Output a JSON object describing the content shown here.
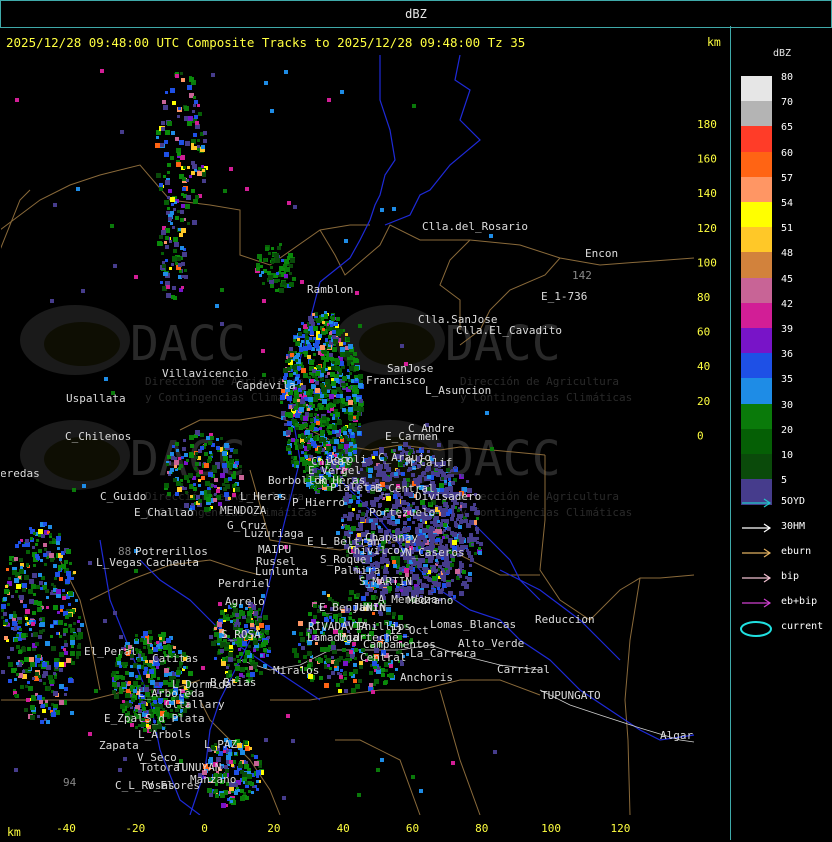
{
  "window": {
    "title": "dBZ"
  },
  "header": {
    "text": "2025/12/28 09:48:00 UTC Composite Tracks to 2025/12/28 09:48:00 Tz 35",
    "km_top": "km",
    "km_bottom": "km"
  },
  "axes": {
    "y_ticks": [
      "180",
      "160",
      "140",
      "120",
      "100",
      "80",
      "60",
      "40",
      "20",
      "0"
    ],
    "x_ticks": [
      "-40",
      "-20",
      "0",
      "20",
      "40",
      "60",
      "80",
      "100",
      "120"
    ]
  },
  "legend": {
    "title": "dBZ",
    "levels": [
      {
        "label": "80",
        "color": "#e6e6e6"
      },
      {
        "label": "70",
        "color": "#b4b4b4"
      },
      {
        "label": "65",
        "color": "#ff3c28"
      },
      {
        "label": "60",
        "color": "#ff6414"
      },
      {
        "label": "57",
        "color": "#ff9664"
      },
      {
        "label": "54",
        "color": "#ffff00"
      },
      {
        "label": "51",
        "color": "#ffc828"
      },
      {
        "label": "48",
        "color": "#d2823c"
      },
      {
        "label": "45",
        "color": "#c86496"
      },
      {
        "label": "42",
        "color": "#d21e96"
      },
      {
        "label": "39",
        "color": "#7814c8"
      },
      {
        "label": "36",
        "color": "#1e50e6"
      },
      {
        "label": "35",
        "color": "#1e8ce6"
      },
      {
        "label": "30",
        "color": "#0a7a0a"
      },
      {
        "label": "20",
        "color": "#055f05"
      },
      {
        "label": "10",
        "color": "#0a4a0a"
      },
      {
        "label": "5",
        "color": "#463c8c"
      }
    ],
    "tracks": [
      {
        "label": "5OYD",
        "color": "#20c8c8"
      },
      {
        "label": "30HM",
        "color": "#ffffff"
      },
      {
        "label": "eburn",
        "color": "#e0b060"
      },
      {
        "label": "bip",
        "color": "#f0c0d0"
      },
      {
        "label": "eb+bip",
        "color": "#d040d0"
      },
      {
        "label": "current",
        "color": "#20e0e0"
      }
    ]
  },
  "watermark": {
    "name": "DACC",
    "line1": "Dirección de Agricultura",
    "line2": "y Contingencias Climáticas"
  },
  "places": [
    {
      "name": "Clla.del_Rosario",
      "c": "#dcdcdc"
    },
    {
      "name": "Encon",
      "c": "#dcdcdc"
    },
    {
      "name": "142",
      "c": "#888"
    },
    {
      "name": "E_1-736",
      "c": "#dcdcdc"
    },
    {
      "name": "Ramblon",
      "c": "#dcdcdc"
    },
    {
      "name": "Clla.SanJose",
      "c": "#dcdcdc"
    },
    {
      "name": "Clla.El_Cavadito",
      "c": "#dcdcdc"
    },
    {
      "name": "Villavicencio",
      "c": "#dcdcdc"
    },
    {
      "name": "Capdevila",
      "c": "#dcdcdc"
    },
    {
      "name": "Francisco",
      "c": "#dcdcdc"
    },
    {
      "name": "SanJose",
      "c": "#dcdcdc"
    },
    {
      "name": "L_Asuncion",
      "c": "#dcdcdc"
    },
    {
      "name": "Uspallata",
      "c": "#dcdcdc"
    },
    {
      "name": "C_Chilenos",
      "c": "#dcdcdc"
    },
    {
      "name": "C_Andre",
      "c": "#dcdcdc"
    },
    {
      "name": "E_Carmen",
      "c": "#dcdcdc"
    },
    {
      "name": "Chical",
      "c": "#dcdcdc"
    },
    {
      "name": "C_Araujo",
      "c": "#dcdcdc"
    },
    {
      "name": "M_Calif",
      "c": "#dcdcdc"
    },
    {
      "name": "eredas",
      "c": "#dcdcdc"
    },
    {
      "name": "E_Vergel",
      "c": "#dcdcdc"
    },
    {
      "name": "Jocoli",
      "c": "#dcdcdc"
    },
    {
      "name": "Borbollon",
      "c": "#dcdcdc"
    },
    {
      "name": "R_Heras",
      "c": "#dcdcdc"
    },
    {
      "name": "Pialetas",
      "c": "#dcdcdc"
    },
    {
      "name": "E_Central",
      "c": "#dcdcdc"
    },
    {
      "name": "Divisadero",
      "c": "#dcdcdc"
    },
    {
      "name": "C_Guido",
      "c": "#dcdcdc"
    },
    {
      "name": "L_Heras",
      "c": "#dcdcdc"
    },
    {
      "name": "P_Hierro",
      "c": "#dcdcdc"
    },
    {
      "name": "E_Challao",
      "c": "#dcdcdc"
    },
    {
      "name": "Portezuelo",
      "c": "#dcdcdc"
    },
    {
      "name": "MENDOZA",
      "c": "#dcdcdc"
    },
    {
      "name": "G_Cruz",
      "c": "#dcdcdc"
    },
    {
      "name": "Luzuriaga",
      "c": "#dcdcdc"
    },
    {
      "name": "Chapanay",
      "c": "#dcdcdc"
    },
    {
      "name": "E_L_Beltran",
      "c": "#dcdcdc"
    },
    {
      "name": "Chivilcoy",
      "c": "#dcdcdc"
    },
    {
      "name": "N_Caseros",
      "c": "#dcdcdc"
    },
    {
      "name": "88",
      "c": "#888"
    },
    {
      "name": "Potrerillos",
      "c": "#dcdcdc"
    },
    {
      "name": "MAIPU",
      "c": "#dcdcdc"
    },
    {
      "name": "Russel",
      "c": "#dcdcdc"
    },
    {
      "name": "L_Vegas",
      "c": "#dcdcdc"
    },
    {
      "name": "Cacheuta",
      "c": "#dcdcdc"
    },
    {
      "name": "S_Roque",
      "c": "#dcdcdc"
    },
    {
      "name": "Lunlunta",
      "c": "#dcdcdc"
    },
    {
      "name": "Palmira",
      "c": "#dcdcdc"
    },
    {
      "name": "Perdriel",
      "c": "#dcdcdc"
    },
    {
      "name": "S_MARTIN",
      "c": "#dcdcdc"
    },
    {
      "name": "Agrelo",
      "c": "#dcdcdc"
    },
    {
      "name": "E_Benjamin",
      "c": "#dcdcdc"
    },
    {
      "name": "JUNIN",
      "c": "#dcdcdc"
    },
    {
      "name": "A_Mendoza",
      "c": "#dcdcdc"
    },
    {
      "name": "Medrano",
      "c": "#dcdcdc"
    },
    {
      "name": "RIVADAVIA",
      "c": "#dcdcdc"
    },
    {
      "name": "Phillips",
      "c": "#dcdcdc"
    },
    {
      "name": "12_Oct",
      "c": "#dcdcdc"
    },
    {
      "name": "Lomas_Blancas",
      "c": "#dcdcdc"
    },
    {
      "name": "Reduccion",
      "c": "#dcdcdc"
    },
    {
      "name": "Lamadrid",
      "c": "#dcdcdc"
    },
    {
      "name": "Ugarteche",
      "c": "#dcdcdc"
    },
    {
      "name": "S_ROSA",
      "c": "#dcdcdc"
    },
    {
      "name": "Alto_Verde",
      "c": "#dcdcdc"
    },
    {
      "name": "Campamentos",
      "c": "#dcdcdc"
    },
    {
      "name": "Central",
      "c": "#dcdcdc"
    },
    {
      "name": "La_Carrera",
      "c": "#dcdcdc"
    },
    {
      "name": "El_Peral",
      "c": "#dcdcdc"
    },
    {
      "name": "Catitas",
      "c": "#dcdcdc"
    },
    {
      "name": "Carrizal",
      "c": "#dcdcdc"
    },
    {
      "name": "Miralos",
      "c": "#dcdcdc"
    },
    {
      "name": "Anchoris",
      "c": "#dcdcdc"
    },
    {
      "name": "B_Btias",
      "c": "#dcdcdc"
    },
    {
      "name": "L_Dormida",
      "c": "#dcdcdc"
    },
    {
      "name": "TUPUNGATO",
      "c": "#dcdcdc"
    },
    {
      "name": "L_Arboleda",
      "c": "#dcdcdc"
    },
    {
      "name": "Gltallary",
      "c": "#dcdcdc"
    },
    {
      "name": "E_Zpal",
      "c": "#dcdcdc"
    },
    {
      "name": "S_d_Plata",
      "c": "#dcdcdc"
    },
    {
      "name": "L_Arbols",
      "c": "#dcdcdc"
    },
    {
      "name": "Zapata",
      "c": "#dcdcdc"
    },
    {
      "name": "L_PAZ",
      "c": "#dcdcdc"
    },
    {
      "name": "Algarrob",
      "c": "#dcdcdc"
    },
    {
      "name": "V_Seco",
      "c": "#dcdcdc"
    },
    {
      "name": "Totoral",
      "c": "#dcdcdc"
    },
    {
      "name": "TUNUYAN",
      "c": "#dcdcdc"
    },
    {
      "name": "Manzano",
      "c": "#dcdcdc"
    },
    {
      "name": "94",
      "c": "#888"
    },
    {
      "name": "C_L_Rosas",
      "c": "#dcdcdc"
    },
    {
      "name": "V_Flores",
      "c": "#dcdcdc"
    }
  ]
}
